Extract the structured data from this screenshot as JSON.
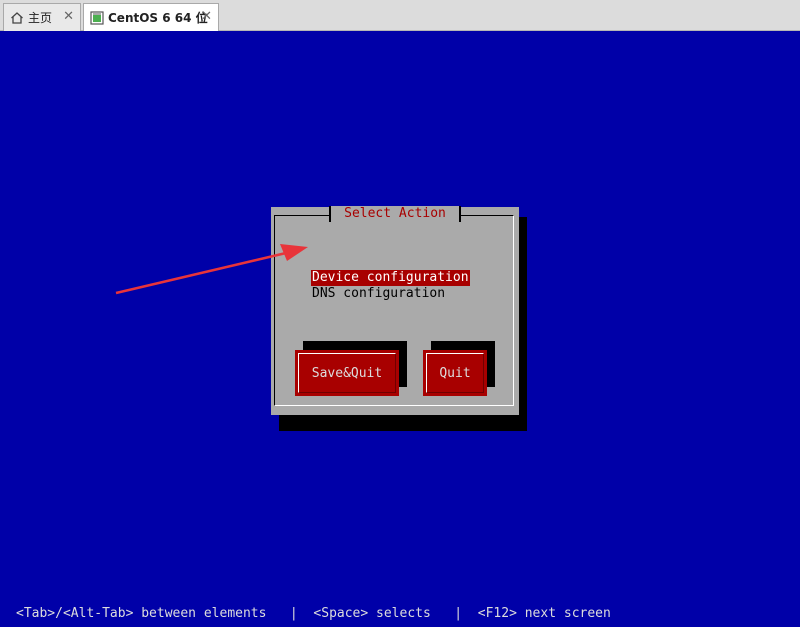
{
  "tabs": [
    {
      "label": "主页",
      "icon": "home-icon",
      "close": "✕"
    },
    {
      "label": "CentOS 6 64 位",
      "icon": "vm-icon",
      "close": "✕"
    }
  ],
  "dialog": {
    "title": "Select Action",
    "menu": [
      {
        "label": "Device configuration",
        "selected": true
      },
      {
        "label": "DNS configuration",
        "selected": false
      }
    ],
    "buttons": {
      "save_quit": "Save&Quit",
      "quit": "Quit"
    }
  },
  "status_bar": "<Tab>/<Alt-Tab> between elements   |  <Space> selects   |  <F12> next screen",
  "colors": {
    "console_bg": "#0000a8",
    "dialog_bg": "#aaaaaa",
    "accent_red": "#a80000",
    "annotation_arrow": "#e8343a"
  }
}
